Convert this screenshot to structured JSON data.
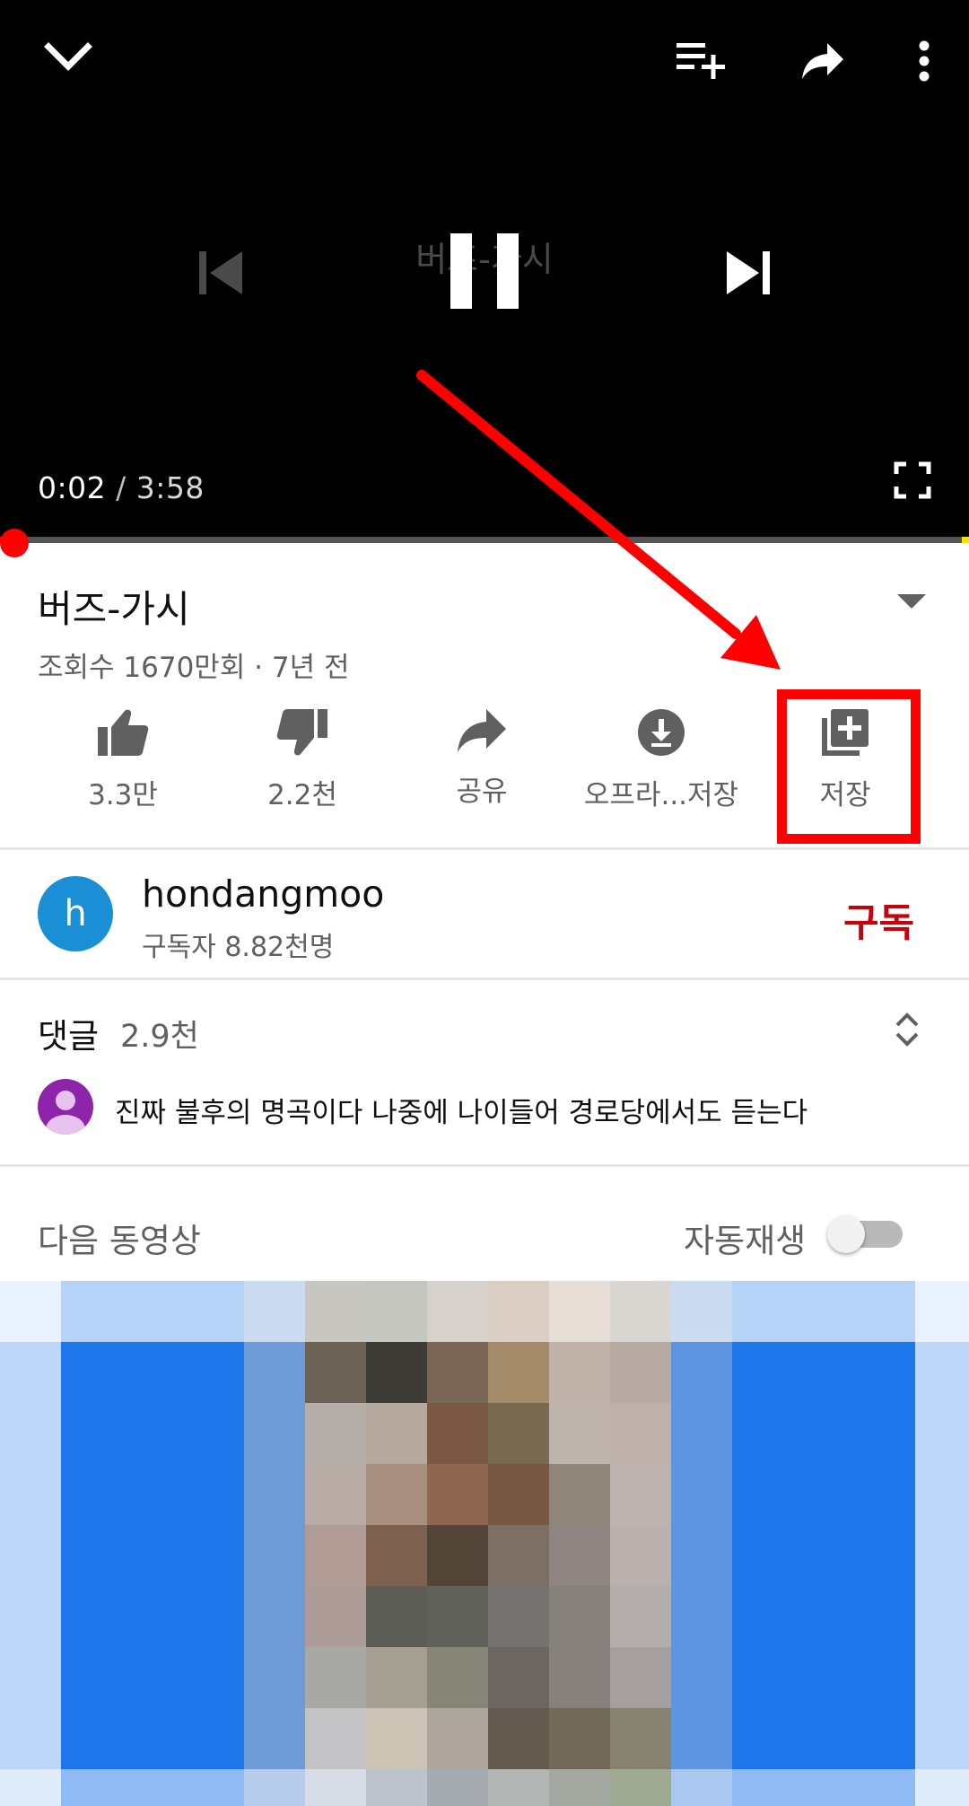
{
  "player": {
    "overlay_title": "버즈-가시",
    "current_time": "0:02",
    "separator": " / ",
    "duration": "3:58",
    "progress_fraction": 0.0084,
    "icons": [
      "chevron-down-icon",
      "add-to-queue-icon",
      "share-icon",
      "more-vert-icon",
      "skip-previous-icon",
      "pause-icon",
      "skip-next-icon",
      "fullscreen-icon"
    ]
  },
  "video": {
    "title": "버즈-가시",
    "meta": "조회수 1670만회 · 7년 전"
  },
  "actions": [
    {
      "label": "3.3만",
      "icon": "thumb-up-icon"
    },
    {
      "label": "2.2천",
      "icon": "thumb-down-icon"
    },
    {
      "label": "공유",
      "icon": "share-icon"
    },
    {
      "label": "오프라...저장",
      "icon": "download-icon"
    },
    {
      "label": "저장",
      "icon": "playlist-add-icon"
    }
  ],
  "channel": {
    "avatar_letter": "h",
    "name": "hondangmoo",
    "subscribers": "구독자 8.82천명",
    "subscribe_label": "구독"
  },
  "comments": {
    "heading": "댓글",
    "count": "2.9천",
    "top_comment": "진짜 불후의 명곡이다 나중에 나이들어 경로당에서도 듣는다"
  },
  "up_next": {
    "label": "다음 동영상",
    "autoplay_label": "자동재생",
    "autoplay_on": false
  },
  "colors": {
    "player_bg": "#000000",
    "progress": "#ff0000",
    "subscribe": "#c4040a",
    "annotation": "#ff0000",
    "channel_avatar": "#1a8fd6",
    "comment_avatar": "#8e24aa"
  }
}
